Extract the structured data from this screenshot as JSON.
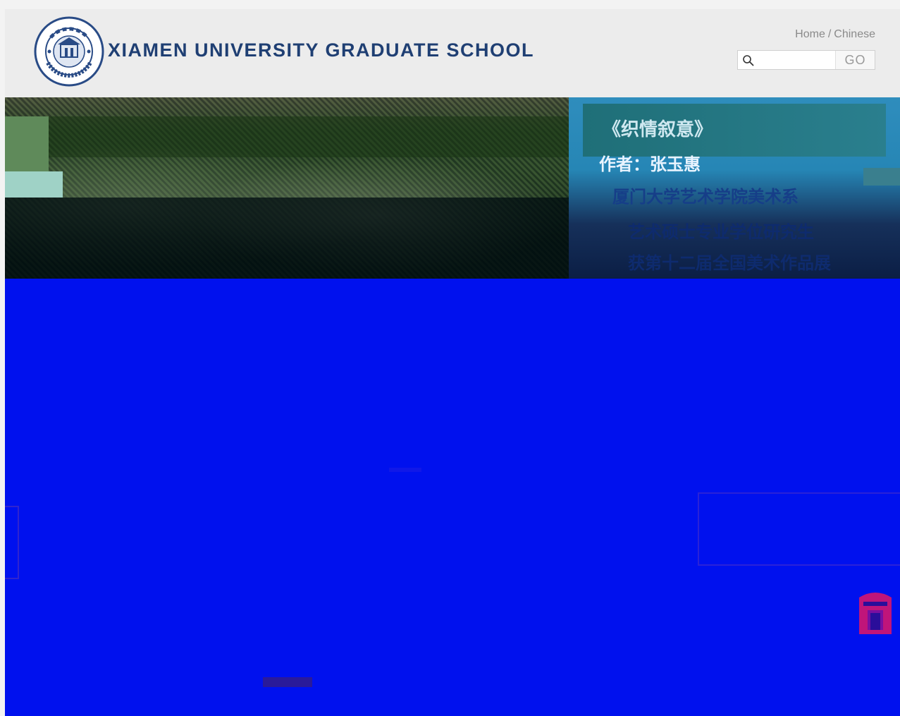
{
  "header": {
    "site_title": "XIAMEN UNIVERSITY GRADUATE SCHOOL",
    "logo_ring_text": "UNIVERSITAS AMOIENSIS"
  },
  "top_links": [
    {
      "label": "Home"
    },
    {
      "label": "Chinese"
    }
  ],
  "search": {
    "placeholder": "",
    "go_label": "GO"
  },
  "banner": {
    "caption": {
      "title": "《织情叙意》",
      "author": "作者：张玉惠",
      "department": "厦门大学艺术学院美术系",
      "degree": "艺术硕士专业学位研究生",
      "award": "获第十二届全国美术作品展"
    }
  },
  "colors": {
    "header_bg": "#ececec",
    "title_color": "#1f3f73",
    "main_bg": "#0011ee",
    "panel_blue": "#2686b5"
  },
  "icons": [
    "university-seal-logo",
    "search-icon",
    "door-icon"
  ]
}
